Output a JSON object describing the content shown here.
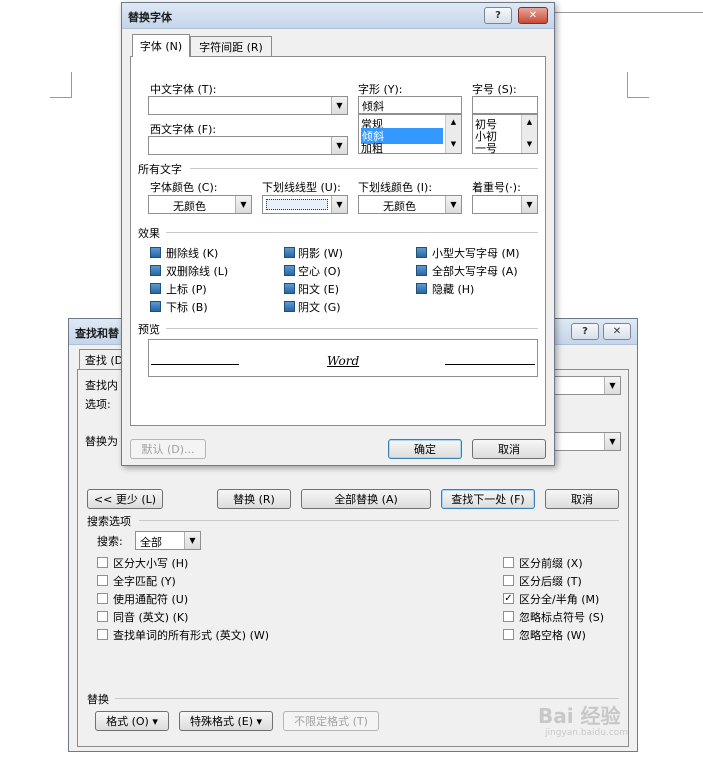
{
  "font_dialog": {
    "title": "替换字体",
    "help_btn": "?",
    "close_btn": "✕",
    "tabs": [
      "字体 (N)",
      "字符间距 (R)"
    ],
    "chinese_font_label": "中文字体 (T):",
    "chinese_font_value": "",
    "western_font_label": "西文字体 (F):",
    "western_font_value": "",
    "style_label": "字形 (Y):",
    "style_value": "倾斜",
    "style_options": [
      "常规",
      "倾斜",
      "加粗"
    ],
    "size_label": "字号 (S):",
    "size_value": "",
    "size_options": [
      "初号",
      "小初",
      "一号"
    ],
    "all_text_label": "所有文字",
    "font_color_label": "字体颜色 (C):",
    "font_color_value": "无颜色",
    "underline_type_label": "下划线线型 (U):",
    "underline_color_label": "下划线颜色 (I):",
    "underline_color_value": "无颜色",
    "emphasis_label": "着重号(·):",
    "effects_label": "效果",
    "effects": [
      [
        "删除线 (K)",
        "阴影 (W)",
        "小型大写字母 (M)"
      ],
      [
        "双删除线 (L)",
        "空心 (O)",
        "全部大写字母 (A)"
      ],
      [
        "上标 (P)",
        "阳文 (E)",
        "隐藏 (H)"
      ],
      [
        "下标 (B)",
        "阴文 (G)",
        ""
      ]
    ],
    "preview_label": "预览",
    "preview_text": "Word",
    "default_btn": "默认 (D)...",
    "ok_btn": "确定",
    "cancel_btn": "取消"
  },
  "find_dialog": {
    "title": "查找和替",
    "help_btn": "?",
    "close_btn": "✕",
    "tab_find": "查找 (D",
    "find_label": "查找内",
    "options_label": "选项:",
    "replace_label": "替换为",
    "less_btn": "<< 更少 (L)",
    "replace_btn": "替换 (R)",
    "replace_all_btn": "全部替换 (A)",
    "find_next_btn": "查找下一处 (F)",
    "cancel_btn": "取消",
    "search_options_label": "搜索选项",
    "search_label": "搜索:",
    "search_value": "全部",
    "left_options": [
      "区分大小写 (H)",
      "全字匹配 (Y)",
      "使用通配符 (U)",
      "同音 (英文) (K)",
      "查找单词的所有形式 (英文) (W)"
    ],
    "right_options": [
      "区分前缀 (X)",
      "区分后缀 (T)",
      "区分全/半角 (M)",
      "忽略标点符号 (S)",
      "忽略空格 (W)"
    ],
    "right_checked": [
      false,
      false,
      true,
      false,
      false
    ],
    "replace_section_label": "替换",
    "format_btn": "格式 (O) ▾",
    "special_btn": "特殊格式 (E) ▾",
    "no_format_btn": "不限定格式 (T)"
  },
  "watermark": {
    "text": "Bai 经验",
    "sub": "jingyan.baidu.com"
  }
}
